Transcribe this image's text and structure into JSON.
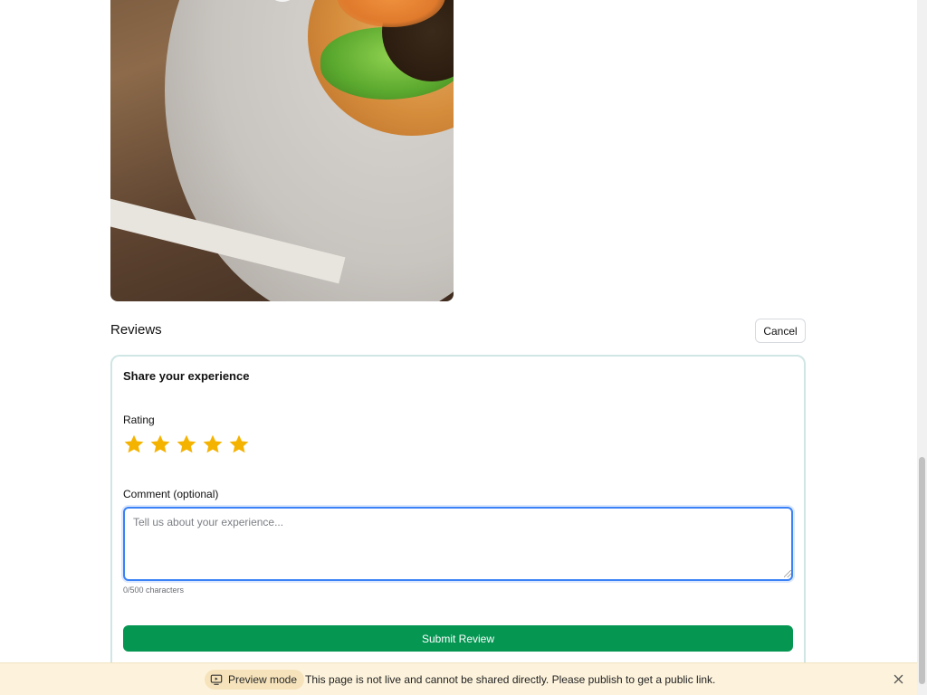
{
  "reviews": {
    "title": "Reviews",
    "cancel_label": "Cancel"
  },
  "form": {
    "title": "Share your experience",
    "rating_label": "Rating",
    "rating": {
      "value": 5,
      "max": 5,
      "star_color": "#f5b301"
    },
    "comment_label": "Comment (optional)",
    "comment_value": "",
    "comment_placeholder": "Tell us about your experience...",
    "char_count": "0/500 characters",
    "submit_label": "Submit Review",
    "submit_color": "#059652"
  },
  "banner": {
    "pill_label": "Preview mode",
    "pill_icon": "monitor-icon",
    "message": "This page is not live and cannot be shared directly. Please publish to get a public link.",
    "close_icon": "close-icon"
  },
  "colors": {
    "accent": "#059652",
    "focus_ring": "#3b82f6",
    "banner_bg": "#fdf3dc",
    "card_border": "#cfe6e4"
  }
}
